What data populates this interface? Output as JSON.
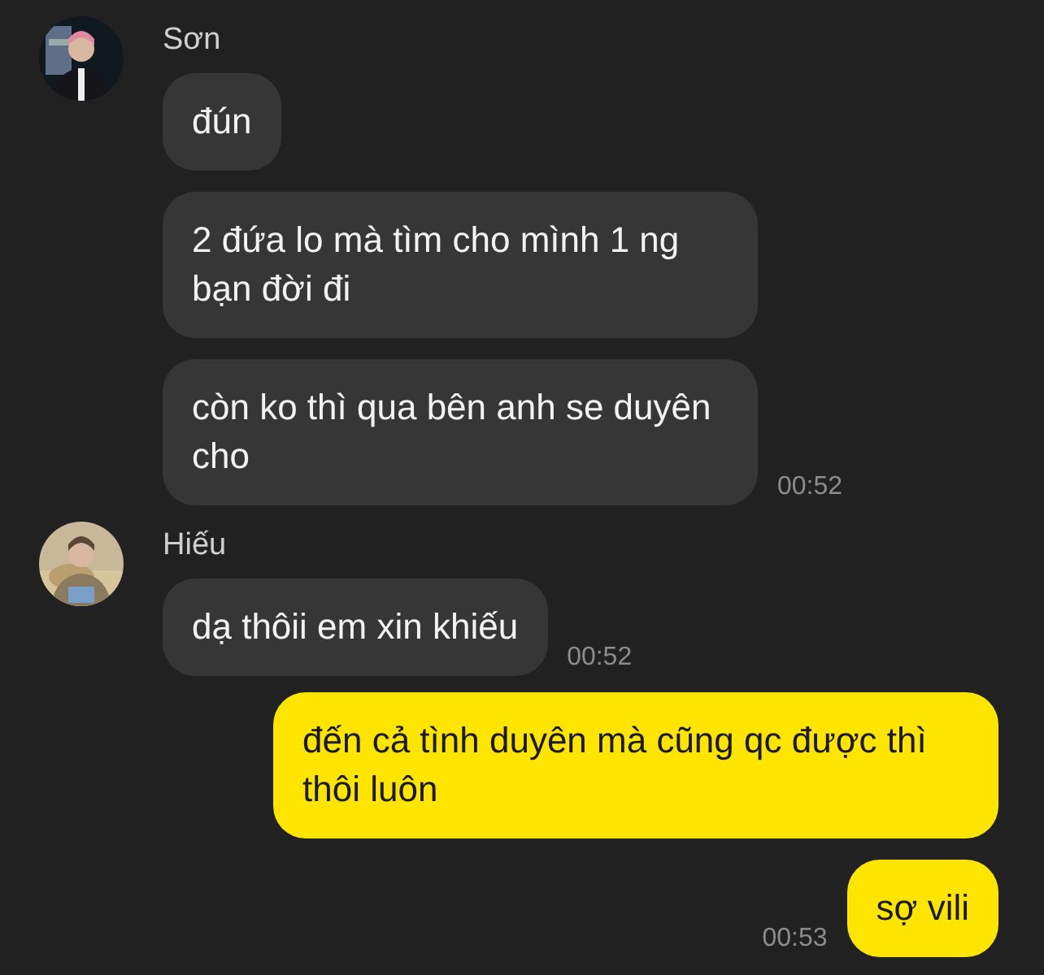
{
  "groups": [
    {
      "kind": "incoming",
      "sender": "Sơn",
      "avatar": {
        "kind": "picture"
      },
      "messages": [
        {
          "text": "đún"
        },
        {
          "text": "2 đứa lo mà tìm cho mình 1 ng bạn đời đi"
        },
        {
          "text": "còn ko thì qua bên anh se duyên cho",
          "time": "00:52"
        }
      ]
    },
    {
      "kind": "incoming",
      "sender": "Hiếu",
      "avatar": {
        "kind": "picture"
      },
      "messages": [
        {
          "text": "dạ thôii em xin khiếu",
          "time": "00:52"
        }
      ]
    },
    {
      "kind": "outgoing",
      "messages": [
        {
          "text": "đến cả tình duyên mà cũng qc được thì thôi luôn"
        },
        {
          "text": "sợ vili",
          "time": "00:53"
        }
      ]
    }
  ]
}
